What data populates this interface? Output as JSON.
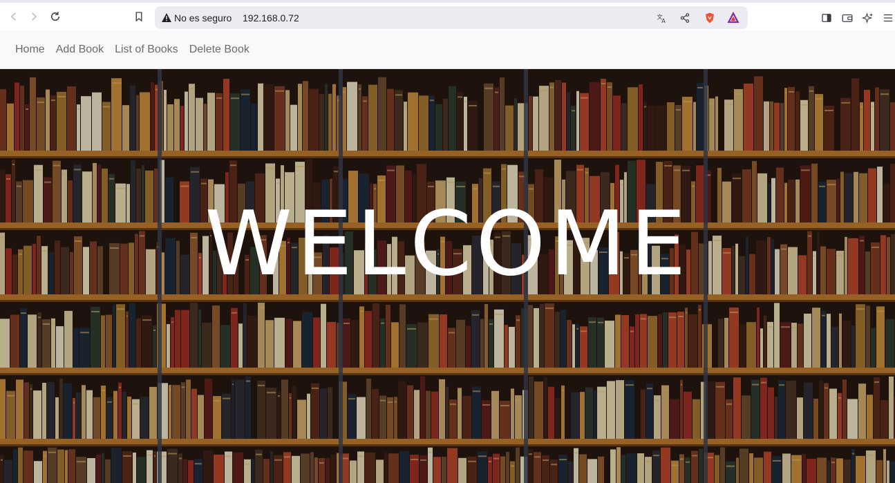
{
  "browser": {
    "security_label": "No es seguro",
    "address": "192.168.0.72"
  },
  "nav": {
    "items": [
      {
        "label": "Home"
      },
      {
        "label": "Add Book"
      },
      {
        "label": "List of Books"
      },
      {
        "label": "Delete Book"
      }
    ]
  },
  "hero": {
    "title": "WELCOME",
    "colors": {
      "shelf_wood": "#b9772f",
      "background": "#2a1c14"
    }
  },
  "icons": [
    "back-icon",
    "forward-icon",
    "reload-icon",
    "bookmark-icon",
    "warning-icon",
    "translate-icon",
    "share-icon",
    "brave-shield-icon",
    "brave-rewards-icon",
    "sidebar-icon",
    "wallet-icon",
    "leo-ai-icon",
    "menu-icon"
  ]
}
